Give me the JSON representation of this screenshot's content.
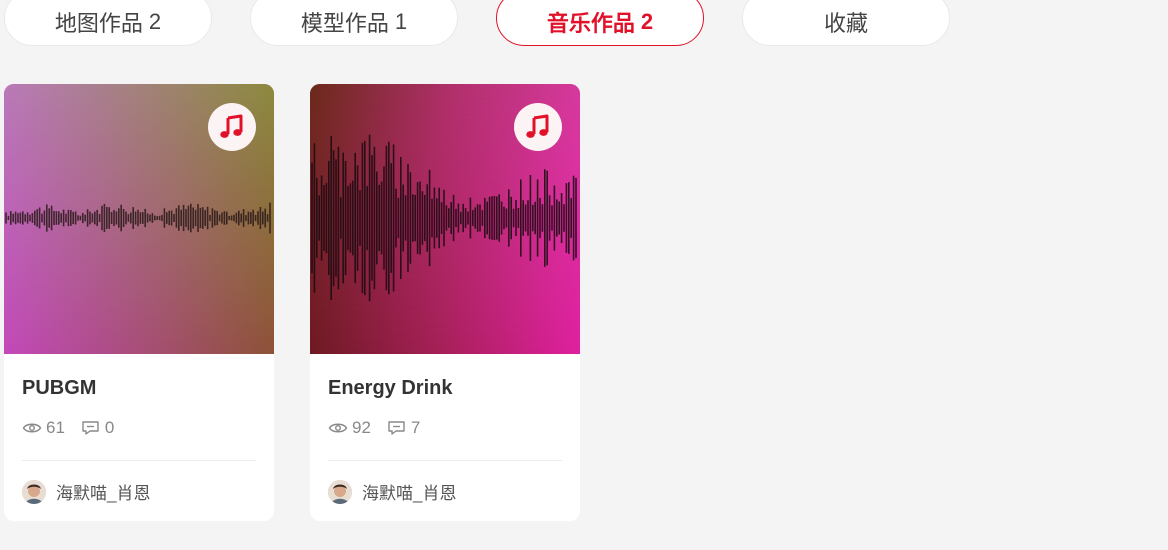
{
  "tabs": [
    {
      "label": "地图作品",
      "count": "2",
      "active": false
    },
    {
      "label": "模型作品",
      "count": "1",
      "active": false
    },
    {
      "label": "音乐作品",
      "count": "2",
      "active": true
    },
    {
      "label": "收藏",
      "count": "",
      "active": false
    }
  ],
  "colors": {
    "accent": "#e2112a",
    "page_background": "#f4f4f4"
  },
  "cards": [
    {
      "title": "PUBGM",
      "views": "61",
      "comments": "0",
      "author": "海默喵_肖恩",
      "badge_icon": "music-note-icon",
      "cover_colors": [
        "#b97ab8",
        "#8c8a3e",
        "#c349ba",
        "#8e5238"
      ]
    },
    {
      "title": "Energy Drink",
      "views": "92",
      "comments": "7",
      "author": "海默喵_肖恩",
      "badge_icon": "music-note-icon",
      "cover_colors": [
        "#6b2a1a",
        "#d83aa0",
        "#6e1a22",
        "#e020a0"
      ]
    }
  ]
}
